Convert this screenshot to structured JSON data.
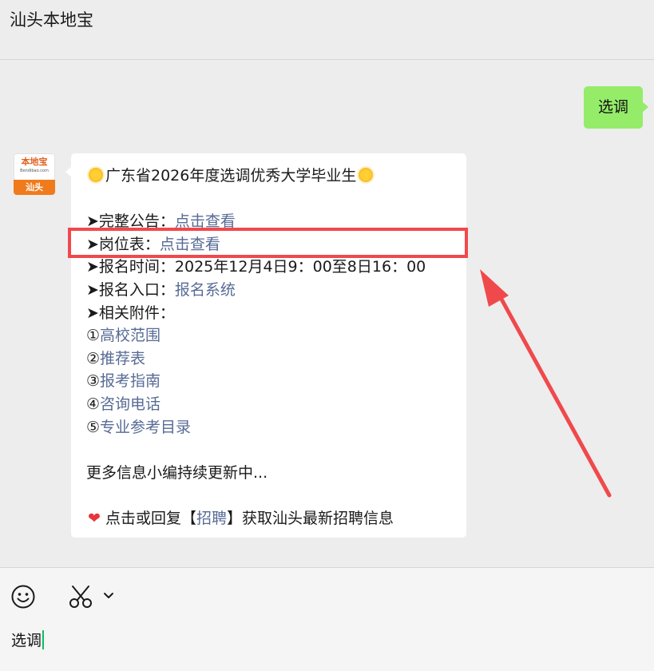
{
  "header": {
    "title": "汕头本地宝"
  },
  "sent_message": {
    "text": "选调"
  },
  "avatar": {
    "brand": "本地宝",
    "url": "Bendibao.com",
    "city": "汕头"
  },
  "received_message": {
    "title": "广东省2026年度选调优秀大学毕业生",
    "lines": [
      {
        "label": "➤完整公告：",
        "link": "点击查看"
      },
      {
        "label": "➤岗位表：",
        "link": "点击查看"
      },
      {
        "label": "➤报名时间：2025年12月4日9：00至8日16：00",
        "link": ""
      },
      {
        "label": "➤报名入口：",
        "link": "报名系统"
      },
      {
        "label": "➤相关附件：",
        "link": ""
      }
    ],
    "attachments": [
      {
        "num": "①",
        "link": "高校范围"
      },
      {
        "num": "②",
        "link": "推荐表"
      },
      {
        "num": "③",
        "link": "报考指南"
      },
      {
        "num": "④",
        "link": "咨询电话"
      },
      {
        "num": "⑤",
        "link": "专业参考目录"
      }
    ],
    "more": "更多信息小编持续更新中...",
    "footer_pre": "点击或回复【",
    "footer_link": "招聘",
    "footer_post": "】获取汕头最新招聘信息"
  },
  "input": {
    "text": "选调"
  },
  "icons": {
    "sun": "sun-emoji-icon",
    "heart": "heart-emoji-icon",
    "emoji": "smiley-icon",
    "scissors": "scissors-icon",
    "chevron": "chevron-down-icon"
  },
  "colors": {
    "sent_bubble": "#95ec69",
    "link": "#576b95",
    "annotation": "#f0494c",
    "caret": "#07c160"
  }
}
